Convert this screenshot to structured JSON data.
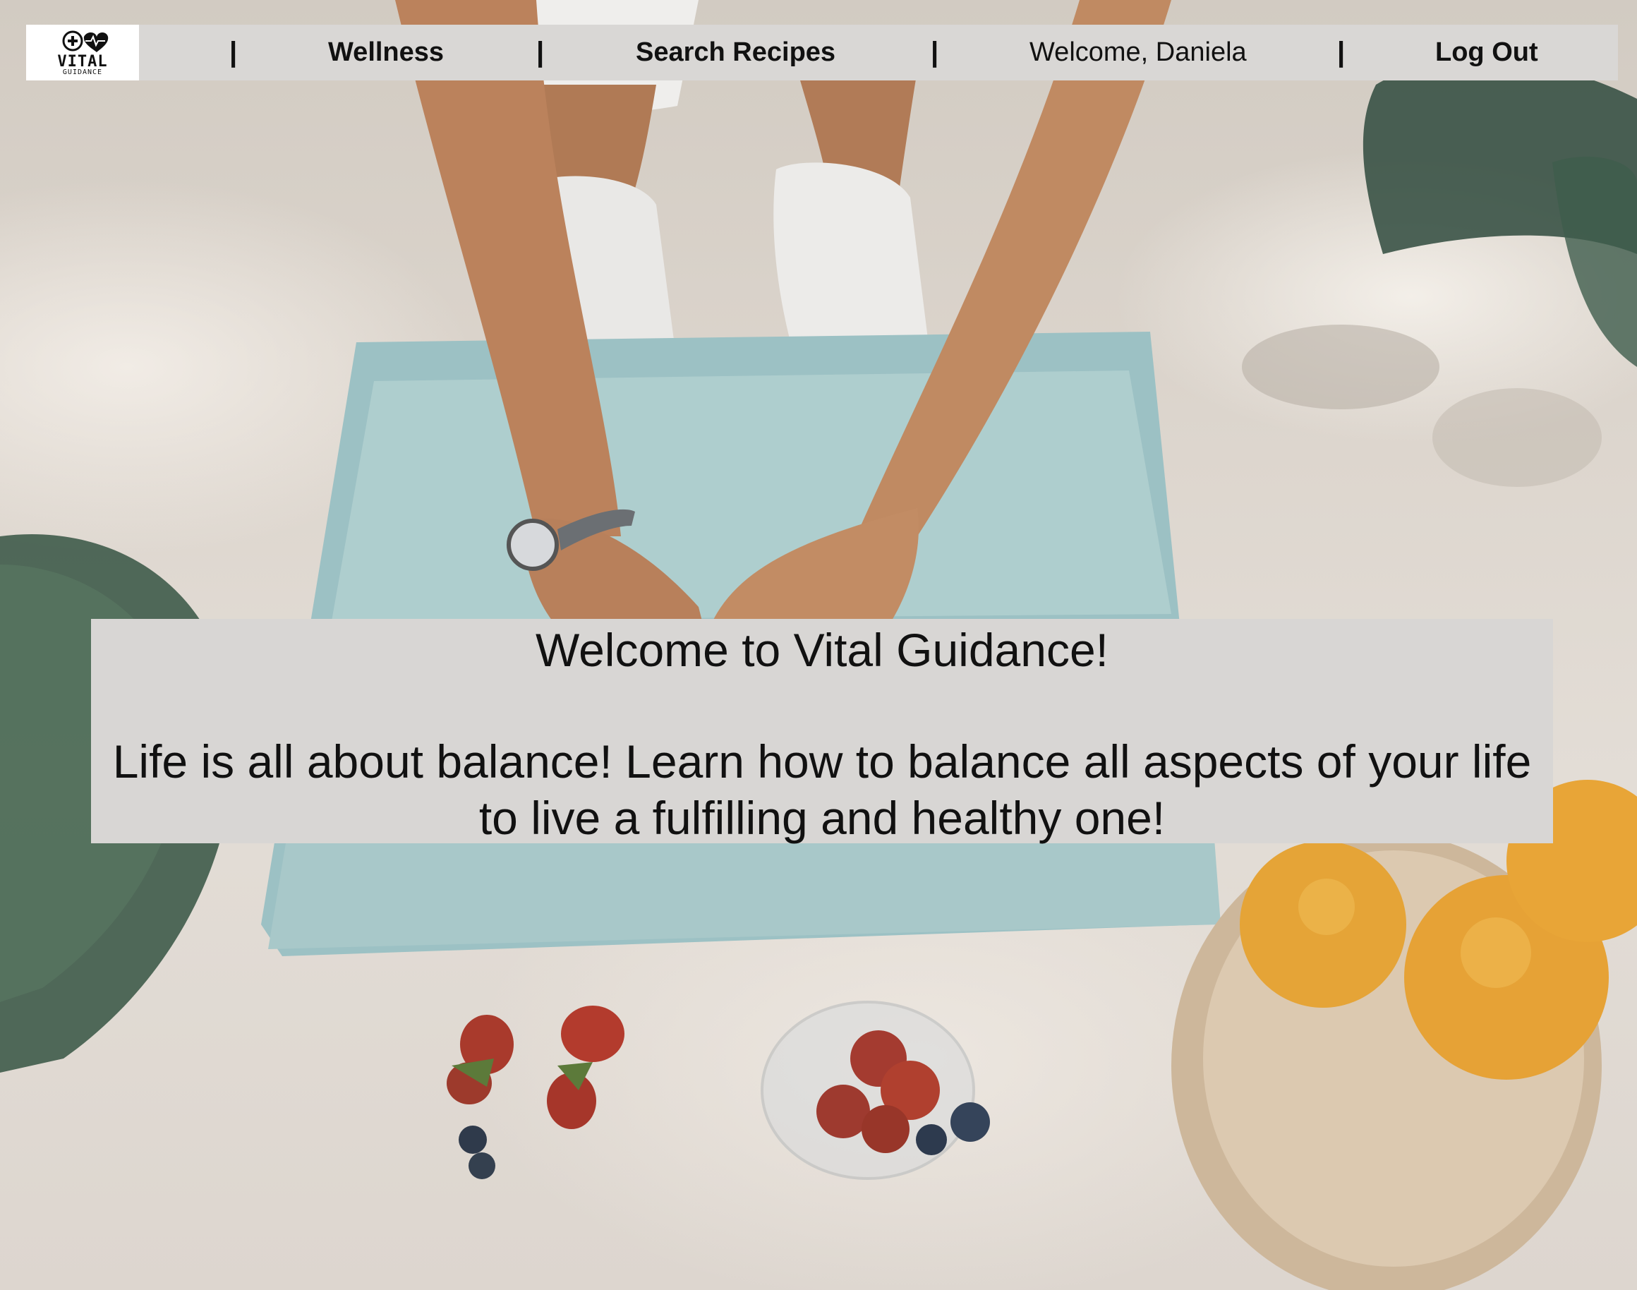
{
  "nav": {
    "logo": {
      "icon": "heart-cross-logo-icon",
      "wordmark": "VITAL",
      "tagline": "GUIDANCE"
    },
    "separator": "|",
    "wellness_label": "Wellness",
    "search_recipes_label": "Search Recipes",
    "welcome_text": "Welcome, Daniela",
    "logout_label": "Log Out",
    "background_color": "#d9d7d5"
  },
  "banner": {
    "title": "Welcome to Vital Guidance!",
    "body_line1": "Life is all about balance! Learn how to balance all aspects of your life",
    "body_line2": "to live a fulfilling and healthy one!",
    "background_color": "#d8d6d4"
  },
  "background": {
    "description_icon": "wellness-photo-background"
  }
}
